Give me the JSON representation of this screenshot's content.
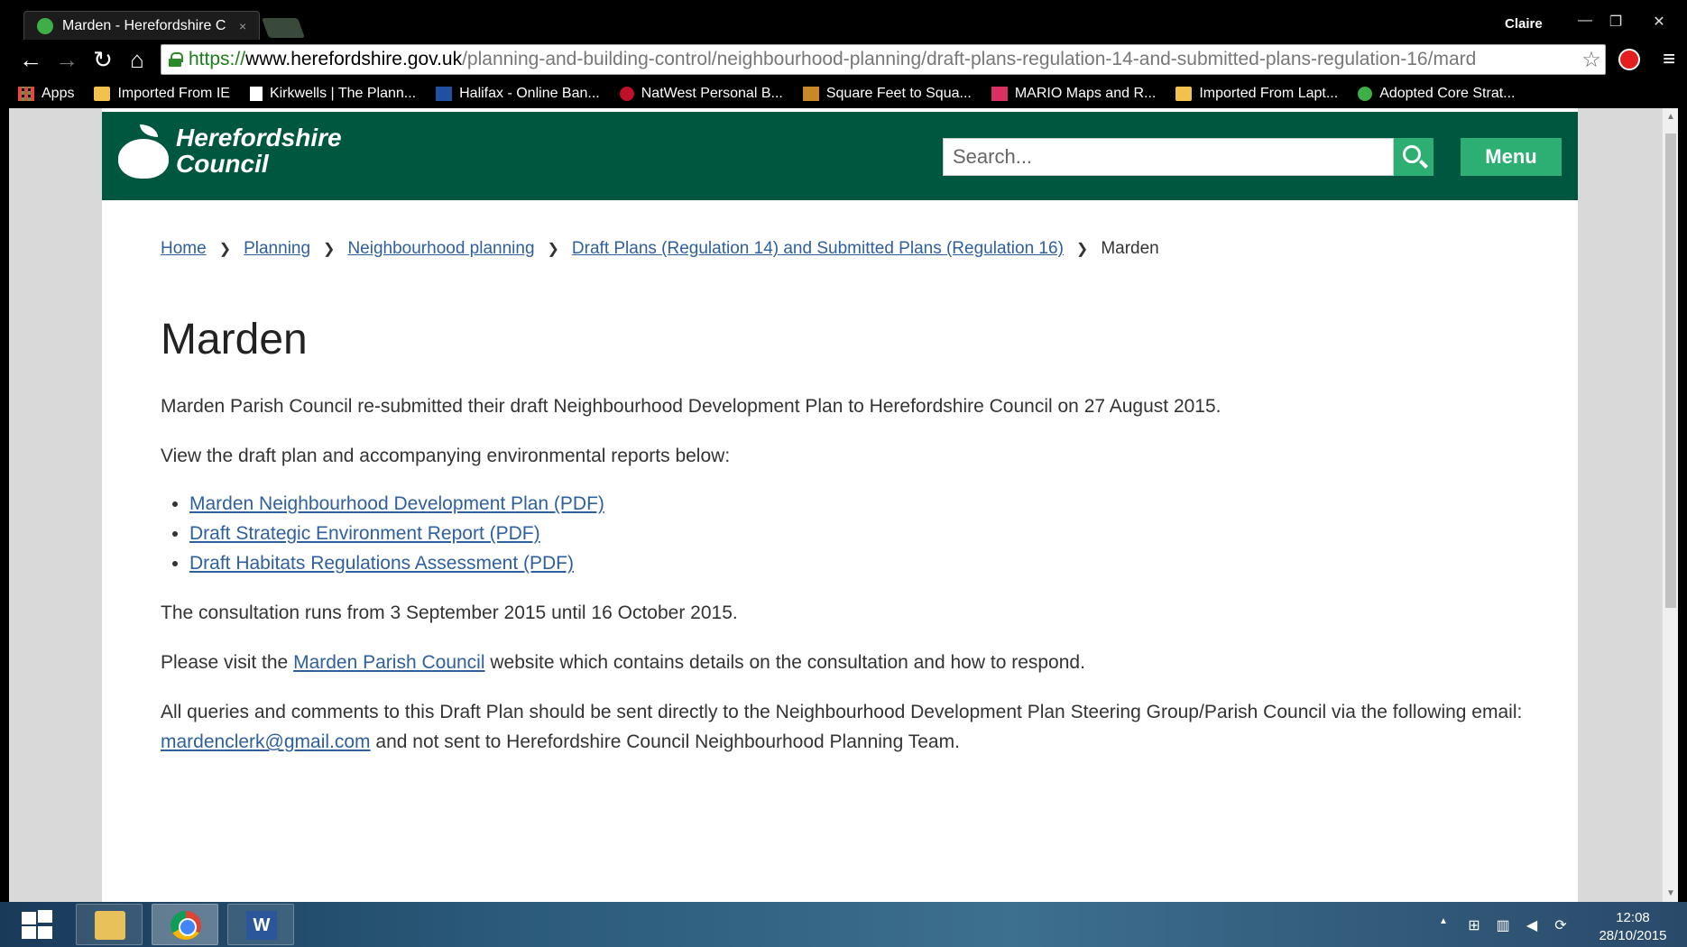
{
  "browser": {
    "tab_title": "Marden - Herefordshire C",
    "tab_close": "×",
    "profile_name": "Claire",
    "url_scheme": "https://",
    "url_host": "www.herefordshire.gov.uk",
    "url_path": "/planning-and-building-control/neighbourhood-planning/draft-plans-regulation-14-and-submitted-plans-regulation-16/mard",
    "nav_back": "←",
    "nav_forward": "→",
    "nav_reload": "↻",
    "nav_home": "⌂",
    "star": "☆",
    "menu": "≡",
    "win_minimize": "—",
    "win_restore": "❐",
    "win_close": "✕",
    "bookmarks": [
      {
        "label": "Apps",
        "icon": "apps-icon"
      },
      {
        "label": "Imported From IE",
        "icon": "folder-icon"
      },
      {
        "label": "Kirkwells | The Plann...",
        "icon": "page-icon"
      },
      {
        "label": "Halifax - Online Ban...",
        "icon": "halifax-icon"
      },
      {
        "label": "NatWest Personal B...",
        "icon": "natwest-icon"
      },
      {
        "label": "Square Feet to Squa...",
        "icon": "sqft-icon"
      },
      {
        "label": "MARIO Maps and R...",
        "icon": "mario-icon"
      },
      {
        "label": "Imported From Lapt...",
        "icon": "folder-icon"
      },
      {
        "label": "Adopted Core Strat...",
        "icon": "apple-icon"
      }
    ]
  },
  "header": {
    "logo_line1": "Herefordshire",
    "logo_line2": "Council",
    "search_placeholder": "Search...",
    "menu_label": "Menu"
  },
  "breadcrumb": {
    "items": [
      "Home",
      "Planning",
      "Neighbourhood planning",
      "Draft Plans (Regulation 14) and Submitted Plans (Regulation 16)"
    ],
    "current": "Marden",
    "separator": "❯"
  },
  "main": {
    "title": "Marden",
    "intro": "Marden Parish Council re-submitted their draft Neighbourhood Development Plan to Herefordshire Council on 27 August 2015.",
    "view_text": "View the draft plan and accompanying environmental reports below:",
    "doc_links": [
      "Marden Neighbourhood Development Plan (PDF)",
      "Draft Strategic Environment Report (PDF)",
      "Draft Habitats Regulations Assessment (PDF)"
    ],
    "consultation": "The consultation runs from 3 September 2015 until 16 October 2015.",
    "visit_prefix": "Please visit the ",
    "visit_link": "Marden Parish Council",
    "visit_suffix": " website which contains details on the consultation and how to respond.",
    "queries_prefix": "All queries and comments to this Draft Plan should be sent directly to the Neighbourhood Development Plan Steering Group/Parish Council via the following email: ",
    "queries_email": "mardenclerk@gmail.com",
    "queries_suffix": " and not sent to Herefordshire Council Neighbourhood Planning Team."
  },
  "taskbar": {
    "word_letter": "W",
    "tray_up": "▲",
    "time": "12:08",
    "date": "28/10/2015"
  },
  "colors": {
    "header_green": "#00573f",
    "button_green": "#2dae73",
    "link_blue": "#2e5f9e"
  }
}
